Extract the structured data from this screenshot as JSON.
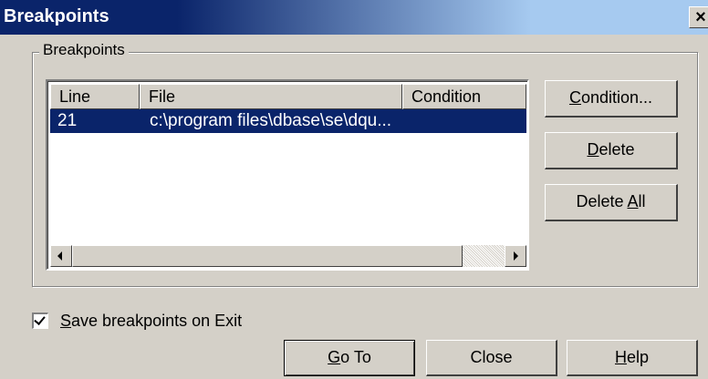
{
  "window": {
    "title": "Breakpoints",
    "close_glyph": "×"
  },
  "group": {
    "legend": "Breakpoints"
  },
  "list": {
    "columns": [
      "Line",
      "File",
      "Condition"
    ],
    "rows": [
      {
        "line": "21",
        "file": "c:\\program files\\dbase\\se\\dqu...",
        "condition": "",
        "selected": true
      }
    ]
  },
  "buttons": {
    "condition": {
      "accel": "C",
      "rest": "ondition..."
    },
    "delete": {
      "accel": "D",
      "rest": "elete"
    },
    "delete_all": {
      "pre": "Delete ",
      "accel": "A",
      "rest": "ll"
    },
    "goto": {
      "accel": "G",
      "rest": "o To"
    },
    "close": "Close",
    "help": {
      "accel": "H",
      "rest": "elp"
    }
  },
  "options": {
    "save_on_exit": {
      "accel": "S",
      "rest": "ave breakpoints on Exit",
      "checked": true
    }
  },
  "colors": {
    "face": "#d4d0c8",
    "selection": "#0a246a",
    "title_start": "#0a246a",
    "title_end": "#a6caf0"
  }
}
